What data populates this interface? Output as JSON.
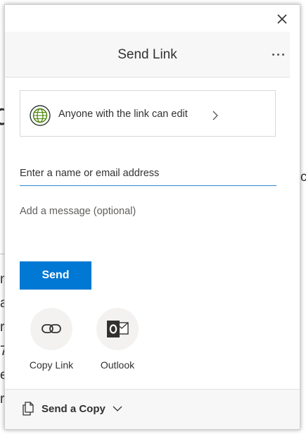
{
  "dialog": {
    "title": "Send Link",
    "close_icon": "close-icon",
    "more_icon": "more-options-icon"
  },
  "permission": {
    "icon": "globe-icon",
    "label": "Anyone with the link can edit",
    "chevron": "chevron-right-icon"
  },
  "recipients": {
    "placeholder": "Enter a name or email address",
    "value": ""
  },
  "message": {
    "placeholder": "Add a message (optional)",
    "value": ""
  },
  "send_button": {
    "label": "Send"
  },
  "share_options": [
    {
      "label": "Copy Link",
      "icon": "link-icon"
    },
    {
      "label": "Outlook",
      "icon": "outlook-icon"
    }
  ],
  "footer": {
    "label": "Send a Copy",
    "icon": "copy-document-icon",
    "chevron": "chevron-down-icon"
  },
  "colors": {
    "accent": "#0078d4",
    "globe_ring": "#498205",
    "outlook_blue": "#0364b8"
  }
}
